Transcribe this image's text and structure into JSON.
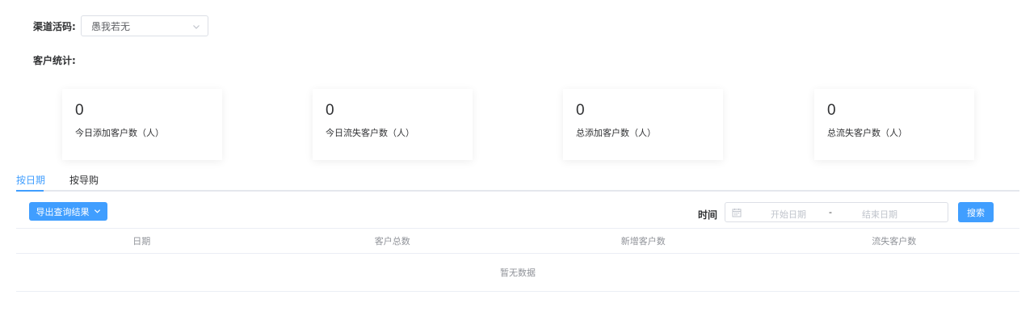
{
  "filter": {
    "channel_label": "渠道活码:",
    "channel_value": "愚我若无"
  },
  "stats": {
    "label": "客户统计:",
    "cards": [
      {
        "value": "0",
        "desc": "今日添加客户数（人）"
      },
      {
        "value": "0",
        "desc": "今日流失客户数（人）"
      },
      {
        "value": "0",
        "desc": "总添加客户数（人）"
      },
      {
        "value": "0",
        "desc": "总流失客户数（人）"
      }
    ]
  },
  "tabs": [
    {
      "label": "按日期",
      "active": true
    },
    {
      "label": "按导购",
      "active": false
    }
  ],
  "toolbar": {
    "export_label": "导出查询结果",
    "time_label": "时间",
    "start_placeholder": "开始日期",
    "range_separator": "-",
    "end_placeholder": "结束日期",
    "search_label": "搜索"
  },
  "table": {
    "columns": [
      "日期",
      "客户总数",
      "新增客户数",
      "流失客户数"
    ],
    "empty_text": "暂无数据"
  },
  "colors": {
    "accent": "#409eff",
    "border": "#dcdfe6"
  }
}
